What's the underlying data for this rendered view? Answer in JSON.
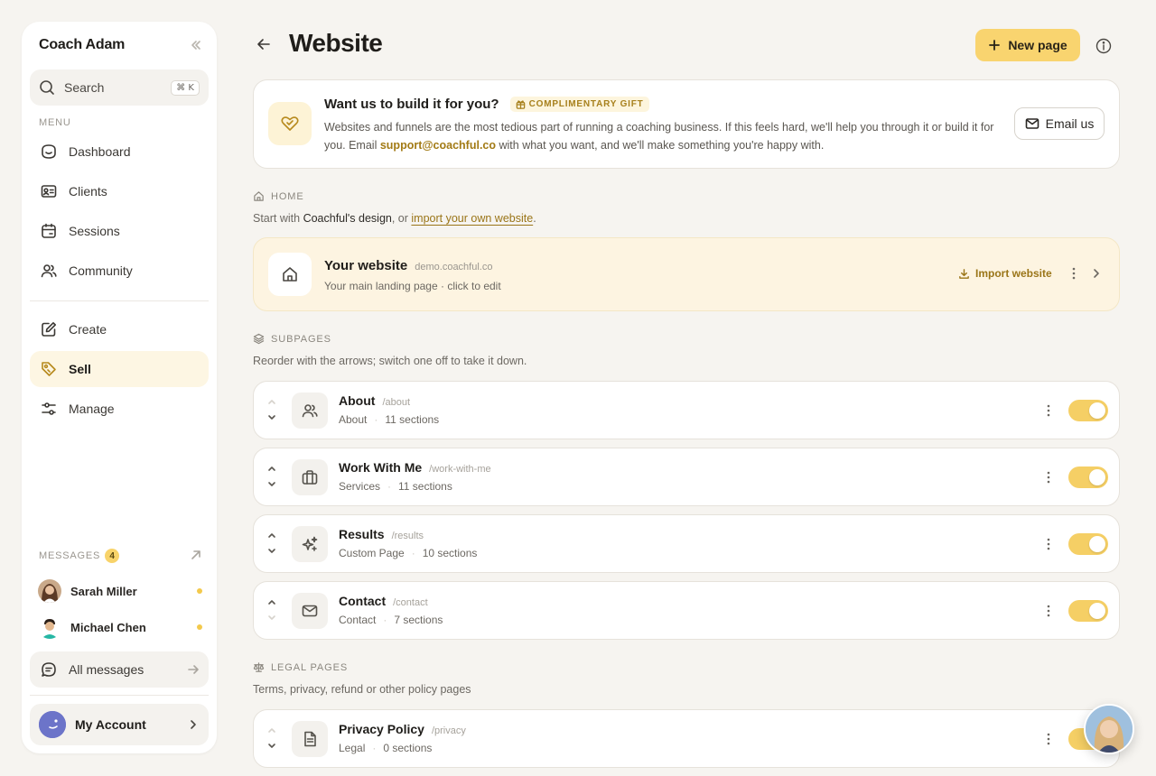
{
  "sidebar": {
    "workspace_name": "Coach Adam",
    "search": {
      "label": "Search",
      "shortcut": "⌘ K"
    },
    "menu_label": "MENU",
    "items": [
      {
        "label": "Dashboard",
        "icon": "smiley-icon"
      },
      {
        "label": "Clients",
        "icon": "id-card-icon"
      },
      {
        "label": "Sessions",
        "icon": "calendar-icon"
      },
      {
        "label": "Community",
        "icon": "people-icon"
      },
      {
        "label": "Create",
        "icon": "edit-icon"
      },
      {
        "label": "Sell",
        "icon": "tag-icon",
        "active": true
      },
      {
        "label": "Manage",
        "icon": "sliders-icon"
      }
    ],
    "messages": {
      "label": "MESSAGES",
      "count": "4",
      "threads": [
        {
          "name": "Sarah Miller",
          "unread": true
        },
        {
          "name": "Michael Chen",
          "unread": true
        }
      ],
      "all_label": "All messages"
    },
    "account_label": "My Account"
  },
  "header": {
    "title": "Website",
    "new_page_label": "New page"
  },
  "promo": {
    "title": "Want us to build it for you?",
    "badge": "COMPLIMENTARY GIFT",
    "body_1": "Websites and funnels are the most tedious part of running a coaching business. If this feels hard, we'll help you through it or build it for you. Email ",
    "email": "support@coachful.co",
    "body_2": " with what you want, and we'll make something you're happy with.",
    "button_label": "Email us"
  },
  "home_section": {
    "label": "HOME",
    "sub_1": "Start with ",
    "sub_strong": "Coachful's design",
    "sub_2": ", or ",
    "sub_link": "import your own website",
    "sub_3": ".",
    "card": {
      "title": "Your website",
      "domain": "demo.coachful.co",
      "subtitle": "Your main landing page · click to edit",
      "import_label": "Import website"
    }
  },
  "subpages_section": {
    "label": "SUBPAGES",
    "sub": "Reorder with the arrows; switch one off to take it down.",
    "pages": [
      {
        "title": "About",
        "slug": "/about",
        "type": "About",
        "sections": "11 sections",
        "icon": "people-icon",
        "enabled": true
      },
      {
        "title": "Work With Me",
        "slug": "/work-with-me",
        "type": "Services",
        "sections": "11 sections",
        "icon": "briefcase-icon",
        "enabled": true
      },
      {
        "title": "Results",
        "slug": "/results",
        "type": "Custom Page",
        "sections": "10 sections",
        "icon": "sparkle-icon",
        "enabled": true
      },
      {
        "title": "Contact",
        "slug": "/contact",
        "type": "Contact",
        "sections": "7 sections",
        "icon": "mail-icon",
        "enabled": true
      }
    ]
  },
  "legal_section": {
    "label": "LEGAL PAGES",
    "sub": "Terms, privacy, refund or other policy pages",
    "pages": [
      {
        "title": "Privacy Policy",
        "slug": "/privacy",
        "type": "Legal",
        "sections": "0 sections",
        "icon": "document-icon",
        "enabled": true
      }
    ]
  },
  "colors": {
    "accent": "#f9d46f",
    "accent_text": "#9a7518",
    "background": "#f6f4f0",
    "active_nav": "#fdf6e3"
  }
}
